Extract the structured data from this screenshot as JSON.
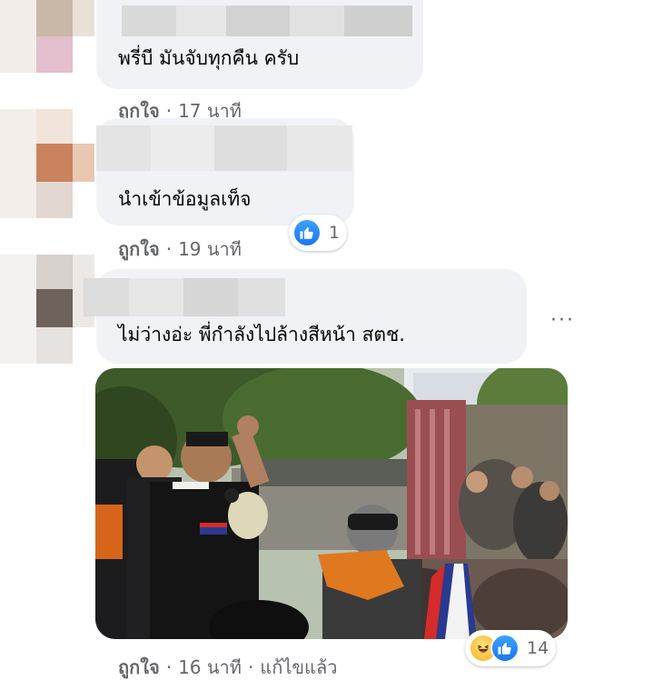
{
  "comments": [
    {
      "text": "พรี่บี มันจับทุกคืน ครับ",
      "like_label": "ถูกใจ",
      "separator": "·",
      "time": "17 นาที"
    },
    {
      "text": "นำเข้าข้อมูลเท็จ",
      "like_label": "ถูกใจ",
      "separator": "·",
      "time": "19 นาที",
      "reaction_count": "1"
    },
    {
      "text": "ไม่ว่างอ่ะ พี่กำลังไปล้างสีหน้า สตช.",
      "like_label": "ถูกใจ",
      "separator": "·",
      "time": "16 นาที",
      "edited": "แก้ไขแล้ว",
      "reaction_count": "14",
      "more_label": "···"
    }
  ],
  "icons": {
    "like": "thumbs-up-icon",
    "haha": "laughing-face-icon",
    "more": "more-options-icon"
  },
  "colors": {
    "bubble": "#f0f2f5",
    "meta_text": "#65676b",
    "like_blue": "#1877f2",
    "haha_yellow": "#f7b125"
  }
}
